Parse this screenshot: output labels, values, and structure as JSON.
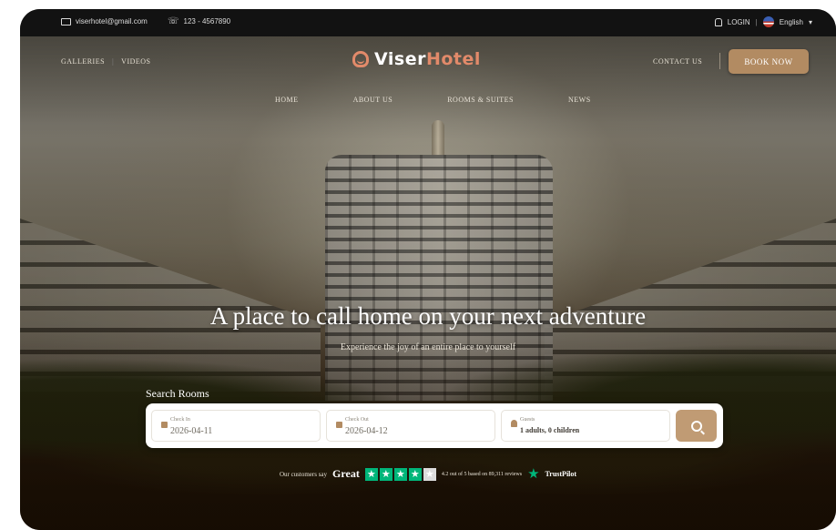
{
  "topbar": {
    "email": "viserhotel@gmail.com",
    "phone": "123 - 4567890",
    "login": "LOGIN",
    "language": "English"
  },
  "header": {
    "nav_left": [
      "GALLERIES",
      "VIDEOS"
    ],
    "logo_part1": "Viser",
    "logo_part2": "Hotel",
    "contact": "CONTACT US",
    "book_now": "BOOK NOW"
  },
  "menu": [
    "HOME",
    "ABOUT US",
    "ROOMS & SUITES",
    "NEWS"
  ],
  "hero": {
    "title": "A place to call home on your next adventure",
    "subtitle": "Experience the joy of an entire place to yourself"
  },
  "search": {
    "title": "Search Rooms",
    "checkin_label": "Check In",
    "checkin_value": "2026-04-11",
    "checkout_label": "Check Out",
    "checkout_value": "2026-04-12",
    "guests_label": "Guests",
    "guests_value": "1 adults, 0 children"
  },
  "trust": {
    "say": "Our customers say",
    "rating_word": "Great",
    "stars_filled": 4,
    "stars_total": 5,
    "info": "4.2 out of 5 based on 89,311 reviews",
    "brand": "TrustPilot"
  },
  "colors": {
    "accent": "#b28b62",
    "logo_accent": "#e28a6a",
    "trustpilot": "#00b67a"
  }
}
